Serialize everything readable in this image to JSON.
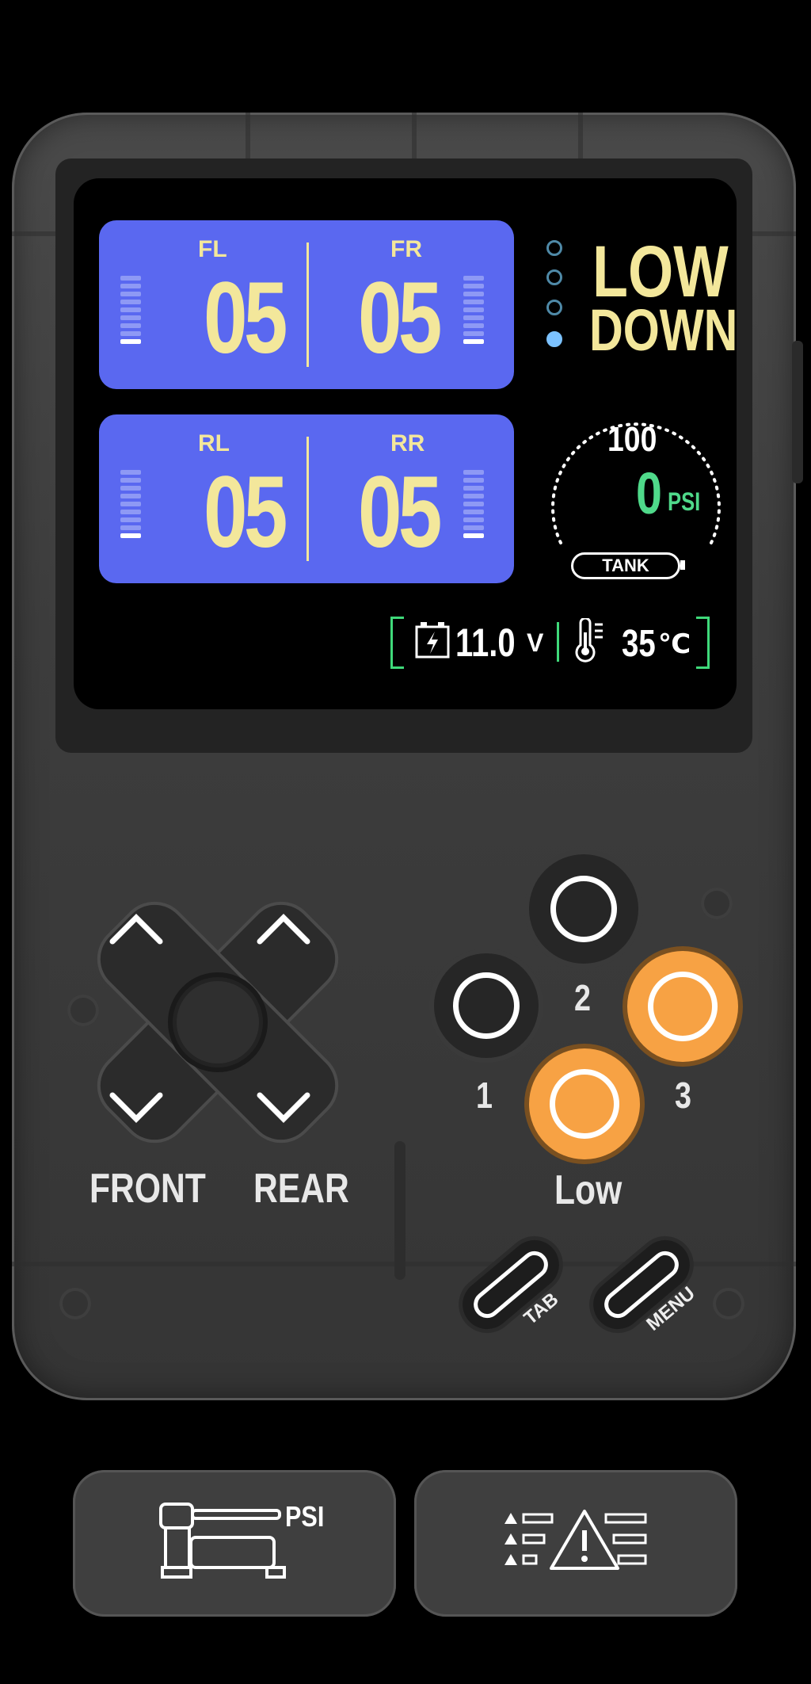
{
  "wheels": {
    "fl": {
      "label": "FL",
      "value": "05"
    },
    "fr": {
      "label": "FR",
      "value": "05"
    },
    "rl": {
      "label": "RL",
      "value": "05"
    },
    "rr": {
      "label": "RR",
      "value": "05"
    }
  },
  "height_mode": {
    "line1": "LOW",
    "line2": "DOWN",
    "preset_dots": [
      false,
      false,
      false,
      true
    ]
  },
  "tank": {
    "max": "100",
    "value": "0",
    "unit": "PSI",
    "label": "TANK"
  },
  "status": {
    "voltage": "11.0",
    "voltage_unit": "V",
    "temperature": "35",
    "temperature_unit": "℃"
  },
  "controls": {
    "front_label": "FRONT",
    "rear_label": "REAR",
    "preset_1": "1",
    "preset_2": "2",
    "preset_3": "3",
    "preset_name": "Low",
    "tab_label": "TAB",
    "menu_label": "MENU"
  },
  "tiles": {
    "compressor_unit": "PSI"
  },
  "colors": {
    "panel": "#5a68f0",
    "value_text": "#f3e79b",
    "tank_value": "#4fd98a",
    "accent_orange": "#f7a244"
  }
}
